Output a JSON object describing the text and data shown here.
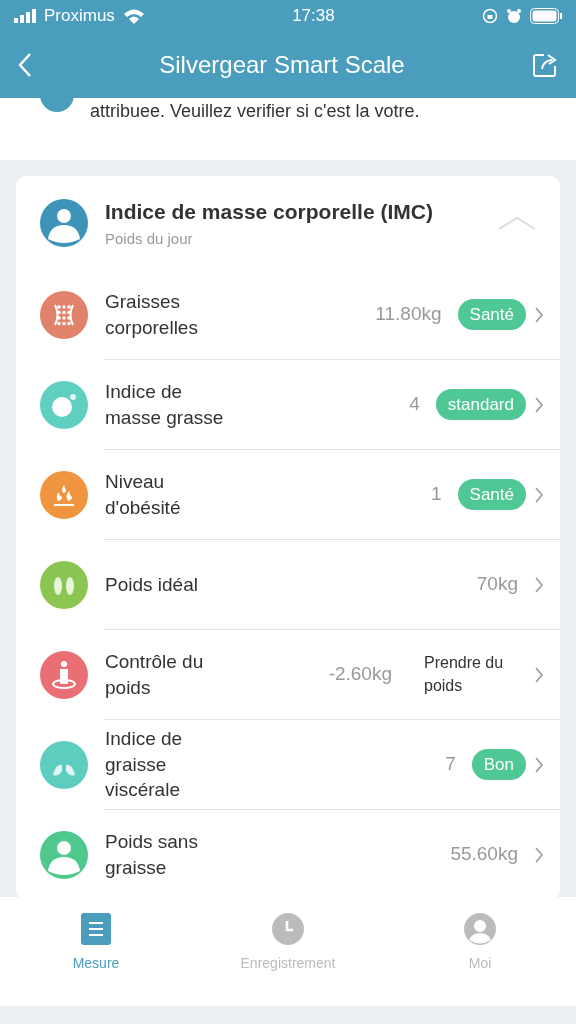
{
  "status_bar": {
    "carrier": "Proximus",
    "time": "17:38"
  },
  "header": {
    "title": "Silvergear Smart Scale"
  },
  "notice": {
    "text": "attribuee. Veuillez verifier si c'est la votre."
  },
  "card": {
    "title": "Indice de masse corporelle (IMC)",
    "subtitle": "Poids du jour",
    "expanded": true,
    "rows": [
      {
        "label": "Graisses corporelles",
        "value": "11.80kg",
        "status": "Santé",
        "kind": "badge",
        "color": "#e0826c"
      },
      {
        "label": "Indice de masse grasse",
        "value": "4",
        "status": "standard",
        "kind": "badge",
        "color": "#5fcfc0"
      },
      {
        "label": "Niveau d'obésité",
        "value": "1",
        "status": "Santé",
        "kind": "badge",
        "color": "#f0953f"
      },
      {
        "label": "Poids idéal",
        "value": "70kg",
        "color": "#8cc652"
      },
      {
        "label": "Contrôle du poids",
        "value": "-2.60kg",
        "status": "Prendre du poids",
        "kind": "text",
        "color": "#ea6f74"
      },
      {
        "label": "Indice de graisse viscérale",
        "value": "7",
        "status": "Bon",
        "kind": "badge",
        "color": "#5ccdbf"
      },
      {
        "label": "Poids sans graisse",
        "value": "55.60kg",
        "color": "#4fc88e"
      }
    ]
  },
  "tabs": [
    {
      "label": "Mesure",
      "selected": true
    },
    {
      "label": "Enregistrement",
      "selected": false
    },
    {
      "label": "Moi",
      "selected": false
    }
  ]
}
